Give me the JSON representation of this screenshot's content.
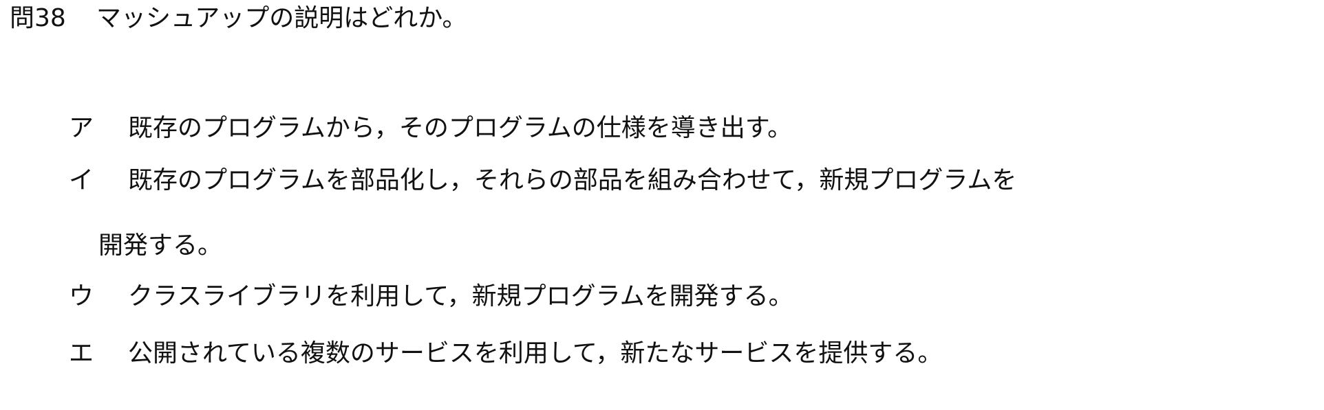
{
  "question": {
    "number": "問38",
    "text": "マッシュアップの説明はどれか。"
  },
  "choices": [
    {
      "label": "ア",
      "text": "既存のプログラムから，そのプログラムの仕様を導き出す。"
    },
    {
      "label": "イ",
      "text": "既存のプログラムを部品化し，それらの部品を組み合わせて，新規プログラムを",
      "continuation": "開発する。"
    },
    {
      "label": "ウ",
      "text": "クラスライブラリを利用して，新規プログラムを開発する。"
    },
    {
      "label": "エ",
      "text": "公開されている複数のサービスを利用して，新たなサービスを提供する。"
    }
  ]
}
